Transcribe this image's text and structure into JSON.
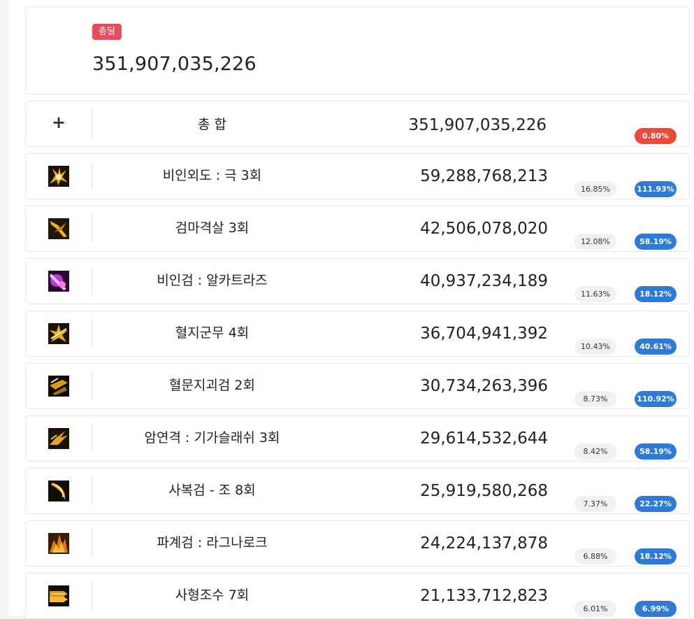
{
  "summary": {
    "tag": "총딜",
    "value": "351,907,035,226"
  },
  "total_row": {
    "expand_icon": "plus-icon",
    "label": "총 합",
    "damage": "351,907,035,226",
    "rate": "0.80%"
  },
  "colors": {
    "tag": "#e74c5f",
    "rate_blue": "#2f7ad6",
    "rate_red": "#ee4a3a",
    "share_pill": "#f1f1f3"
  },
  "skills": [
    {
      "name": "비인외도 : 극 3회",
      "damage": "59,288,768,213",
      "share": "16.85%",
      "rate": "111.93%",
      "icon": "skill-icon-biinoedo"
    },
    {
      "name": "검마격살 3회",
      "damage": "42,506,078,020",
      "share": "12.08%",
      "rate": "58.19%",
      "icon": "skill-icon-geommagyeoksal"
    },
    {
      "name": "비인검 : 알카트라즈",
      "damage": "40,937,234,189",
      "share": "11.63%",
      "rate": "18.12%",
      "icon": "skill-icon-alcatraz"
    },
    {
      "name": "혈지군무 4회",
      "damage": "36,704,941,392",
      "share": "10.43%",
      "rate": "40.61%",
      "icon": "skill-icon-hyeoljigunmu"
    },
    {
      "name": "혈문지괴검 2회",
      "damage": "30,734,263,396",
      "share": "8.73%",
      "rate": "110.92%",
      "icon": "skill-icon-hyeolmunjigoegeom"
    },
    {
      "name": "암연격 : 기가슬래쉬 3회",
      "damage": "29,614,532,644",
      "share": "8.42%",
      "rate": "58.19%",
      "icon": "skill-icon-gigaslash"
    },
    {
      "name": "사복검 - 조 8회",
      "damage": "25,919,580,268",
      "share": "7.37%",
      "rate": "22.27%",
      "icon": "skill-icon-sabokgeom"
    },
    {
      "name": "파계검 : 라그나로크",
      "damage": "24,224,137,878",
      "share": "6.88%",
      "rate": "18.12%",
      "icon": "skill-icon-ragnarok"
    },
    {
      "name": "사형조수 7회",
      "damage": "21,133,712,823",
      "share": "6.01%",
      "rate": "6.99%",
      "icon": "skill-icon-sahyeongjosu"
    }
  ]
}
